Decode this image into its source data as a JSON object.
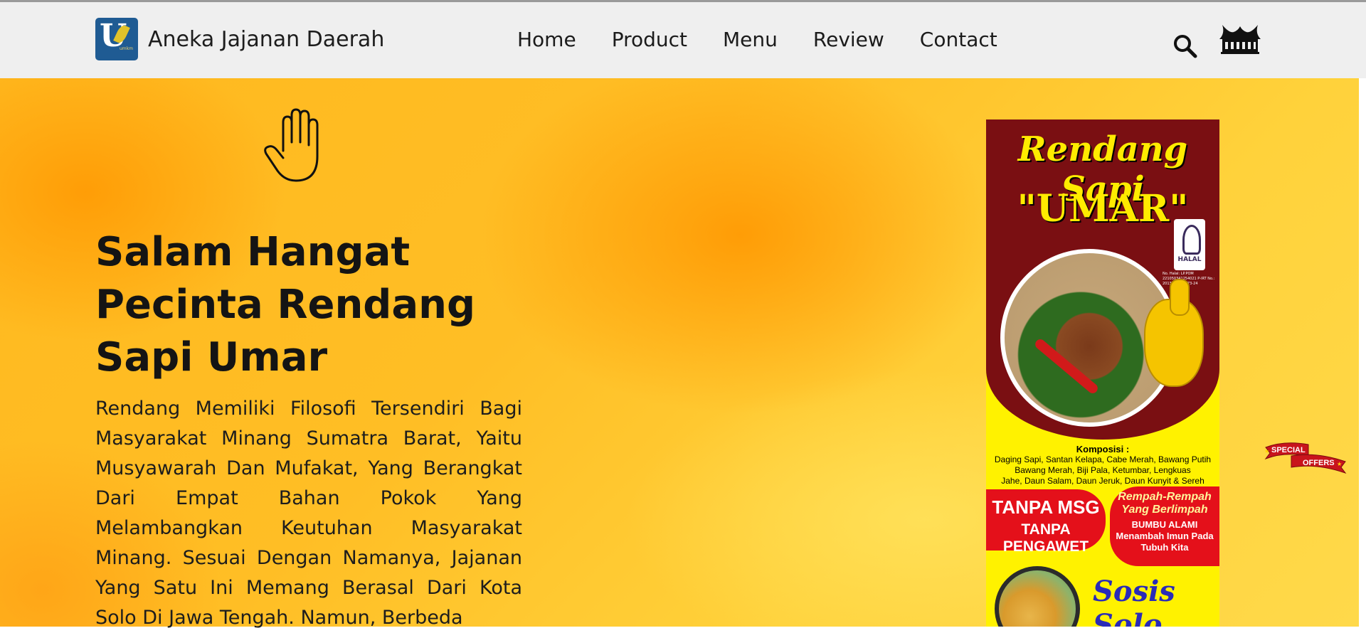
{
  "brand": {
    "name": "Aneka Jajanan Daerah",
    "logo_letter": "U",
    "logo_small_text": "umkm"
  },
  "nav": {
    "links": [
      {
        "label": "Home"
      },
      {
        "label": "Product"
      },
      {
        "label": "Menu"
      },
      {
        "label": "Review"
      },
      {
        "label": "Contact"
      }
    ]
  },
  "icons": {
    "search": "search-icon",
    "rumah_gadang": "rumah-gadang-icon",
    "hand": "waving-hand-icon"
  },
  "hero": {
    "title_lines": [
      "Salam Hangat",
      "Pecinta Rendang",
      "Sapi Umar"
    ],
    "description": "Rendang Memiliki Filosofi Tersendiri Bagi Masyarakat Minang Sumatra Barat, Yaitu Musyawarah Dan Mufakat, Yang Berangkat Dari Empat Bahan Pokok Yang Melambangkan Keutuhan Masyarakat Minang. Sesuai Dengan Namanya, Jajanan Yang Satu Ini Memang Berasal Dari Kota Solo Di Jawa Tengah. Namun, Berbeda"
  },
  "poster": {
    "title": "Rendang Sapi",
    "subtitle": "\"UMAR\"",
    "halal_label": "HALAL",
    "ref_text": "No. Halal: LP.POM 221050341254021 P-IRT No.: 2013271010873-24",
    "komposisi_title": "Komposisi :",
    "komposisi_lines": [
      "Daging Sapi, Santan Kelapa, Cabe Merah, Bawang Putih",
      "Bawang Merah, Biji Pala, Ketumbar, Lengkuas",
      "Jahe, Daun Salam, Daun Jeruk, Daun Kunyit & Sereh"
    ],
    "msg_line1": "TANPA MSG",
    "msg_line2": "TANPA PENGAWET",
    "rempah_line1": "Rempah-Rempah Yang Berlimpah",
    "rempah_line2": "BUMBU ALAMI Menambah Imun Pada Tubuh Kita",
    "sosis_text": "Sosis Solo"
  },
  "offer_badge": {
    "line1": "SPECIAL",
    "line2": "OFFERS"
  },
  "colors": {
    "navbar_bg": "#efefef",
    "hero_orange": "#ffb91f",
    "poster_maroon": "#7a0f12",
    "poster_yellow": "#fff200",
    "poster_red": "#e4101a",
    "logo_blue": "#1f5b93"
  }
}
